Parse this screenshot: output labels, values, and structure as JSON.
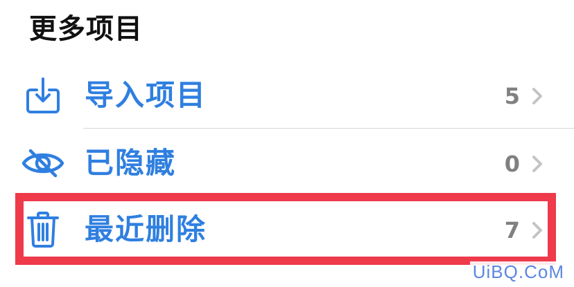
{
  "section": {
    "title": "更多项目"
  },
  "items": [
    {
      "label": "导入项目",
      "count": "5",
      "icon": "import-tray-icon"
    },
    {
      "label": "已隐藏",
      "count": "0",
      "icon": "eye-slash-icon"
    },
    {
      "label": "最近删除",
      "count": "7",
      "icon": "trash-icon"
    }
  ],
  "colors": {
    "accent": "#2f7fe0",
    "count_gray": "#808080",
    "highlight": "#ee3a4a"
  },
  "watermark": "UiBQ.CoM"
}
